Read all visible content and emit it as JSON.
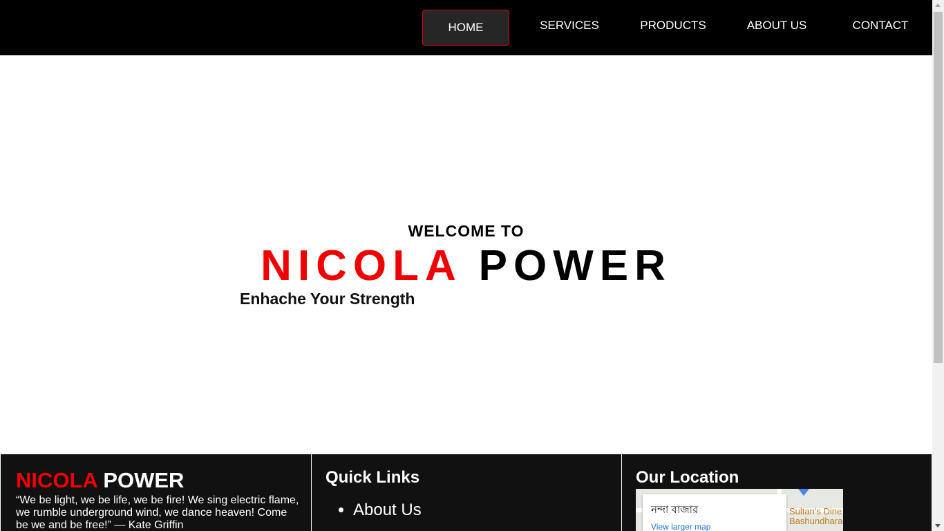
{
  "nav": {
    "items": [
      {
        "label": "HOME",
        "active": true
      },
      {
        "label": "SERVICES",
        "active": false
      },
      {
        "label": "PRODUCTS",
        "active": false
      },
      {
        "label": "ABOUT US",
        "active": false
      },
      {
        "label": "CONTACT",
        "active": false
      }
    ]
  },
  "hero": {
    "welcome": "WELCOME TO",
    "title_red": "NICOLA",
    "title_black": "POWER",
    "tagline": "Enhache Your Strength"
  },
  "footer": {
    "brand_red": "NICOLA",
    "brand_white": "POWER",
    "quote": "“We be light, we be life, we be fire! We sing electric flame, we rumble underground wind, we dance heaven! Come be we and be free!” — Kate Griffin",
    "quick_links": {
      "heading": "Quick Links",
      "items": [
        "About Us"
      ]
    },
    "location": {
      "heading": "Our Location",
      "map_place": "নন্দা বাজার",
      "map_link": "View larger map",
      "map_label": "Sultan's Dine Bashundhara"
    }
  },
  "colors": {
    "accent_red": "#f00000",
    "nav_bg": "#000000",
    "footer_bg": "#111111"
  }
}
